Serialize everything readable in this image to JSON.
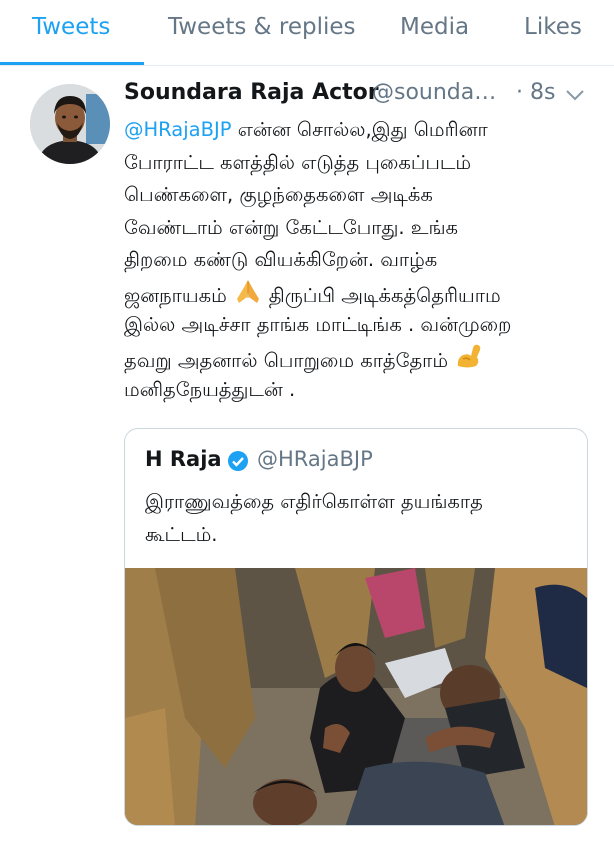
{
  "tabs": [
    {
      "label": "Tweets",
      "active": true
    },
    {
      "label": "Tweets & replies",
      "active": false
    },
    {
      "label": "Media",
      "active": false
    },
    {
      "label": "Likes",
      "active": false
    }
  ],
  "tweet": {
    "display_name": "Soundara Raja Actor",
    "handle": "@soundar...",
    "timestamp": "· 8s",
    "mention": "@HRajaBJP",
    "line1_rest": " என்ன சொல்ல,இது மெரினா",
    "line2": "போராட்ட களத்தில் எடுத்த புகைப்படம்",
    "line3": "பெண்களை, குழந்தைகளை அடிக்க",
    "line4": "வேண்டாம் என்று கேட்டபோது. உங்க",
    "line5": "திறமை கண்டு வியக்கிறேன். வாழ்க",
    "line6_a": "ஜனநாயகம்",
    "line6_b": "திருப்பி அடிக்கத்தெரியாம",
    "line7": "இல்ல அடிச்சா தாங்க மாட்டிங்க . வன்முறை",
    "line8": "தவறு அதனால் பொறுமை காத்தோம்",
    "line9": "மனிதநேயத்துடன் ."
  },
  "quoted": {
    "display_name": "H Raja",
    "handle": "@HRajaBJP",
    "line1": "இராணுவத்தை எதிர்கொள்ள தயங்காத",
    "line2": "கூட்டம்."
  },
  "icons": {
    "caret": "chevron-down-icon",
    "verified": "verified-badge-icon",
    "emoji_1": "folded-hands-emoji",
    "emoji_2": "flexed-biceps-emoji"
  },
  "colors": {
    "accent": "#1da1f2",
    "secondary_text": "#657786",
    "primary_text": "#14171a",
    "border": "#ccd6dd"
  }
}
